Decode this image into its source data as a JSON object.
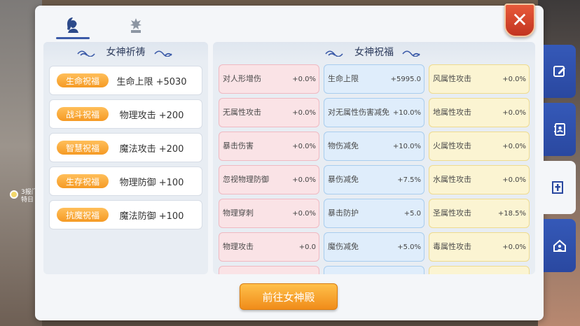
{
  "icons": {
    "tab_goddess": "goddess-portrait-icon",
    "tab_statue": "statue-icon",
    "close": "close-icon",
    "side_edit": "edit-icon",
    "side_book": "contacts-book-icon",
    "side_cross": "cross-icon",
    "side_house": "house-icon"
  },
  "colors": {
    "accent": "#3b5aa8",
    "badge_orange": "#f59a24",
    "close_red": "#c23420",
    "pink_cell": "#fae3e6",
    "blue_cell": "#dfedfb",
    "yellow_cell": "#fbf4d2"
  },
  "background": {
    "marker_text": "3报门\n特日"
  },
  "left_panel": {
    "title": "女神祈祷",
    "blessings": [
      {
        "badge": "生命祝福",
        "value": "生命上限 +5030"
      },
      {
        "badge": "战斗祝福",
        "value": "物理攻击 +200"
      },
      {
        "badge": "智慧祝福",
        "value": "魔法攻击 +200"
      },
      {
        "badge": "生存祝福",
        "value": "物理防御 +100"
      },
      {
        "badge": "抗魔祝福",
        "value": "魔法防御 +100"
      }
    ]
  },
  "right_panel": {
    "title": "女神祝福",
    "rows": [
      [
        {
          "name": "对人形增伤",
          "value": "+0.0%"
        },
        {
          "name": "生命上限",
          "value": "+5995.0"
        },
        {
          "name": "风属性攻击",
          "value": "+0.0%"
        }
      ],
      [
        {
          "name": "无属性攻击",
          "value": "+0.0%"
        },
        {
          "name": "对无属性伤害减免",
          "value": "+10.0%"
        },
        {
          "name": "地属性攻击",
          "value": "+0.0%"
        }
      ],
      [
        {
          "name": "暴击伤害",
          "value": "+0.0%"
        },
        {
          "name": "物伤减免",
          "value": "+10.0%"
        },
        {
          "name": "火属性攻击",
          "value": "+0.0%"
        }
      ],
      [
        {
          "name": "忽视物理防御",
          "value": "+0.0%"
        },
        {
          "name": "暴伤减免",
          "value": "+7.5%"
        },
        {
          "name": "水属性攻击",
          "value": "+0.0%"
        }
      ],
      [
        {
          "name": "物理穿刺",
          "value": "+0.0%"
        },
        {
          "name": "暴击防护",
          "value": "+5.0"
        },
        {
          "name": "圣属性攻击",
          "value": "+18.5%"
        }
      ],
      [
        {
          "name": "物理攻击",
          "value": "+0.0"
        },
        {
          "name": "魔伤减免",
          "value": "+5.0%"
        },
        {
          "name": "毒属性攻击",
          "value": "+0.0%"
        }
      ],
      [
        {
          "name": "",
          "value": ""
        },
        {
          "name": "",
          "value": ""
        },
        {
          "name": "",
          "value": ""
        }
      ]
    ]
  },
  "goto_button": "前往女神殿",
  "close_label": "✕"
}
